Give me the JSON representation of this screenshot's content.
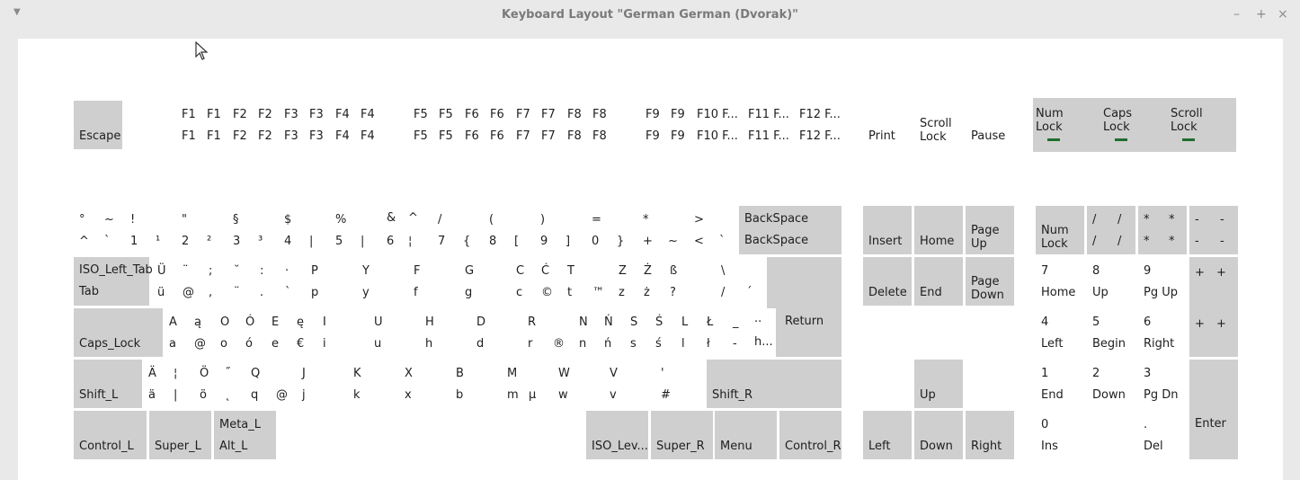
{
  "window": {
    "title": "Keyboard Layout \"German German (Dvorak)\"",
    "menu_icon": "triangle-down-icon",
    "minimize": "–",
    "maximize": "+",
    "close": "×"
  },
  "colors": {
    "key_grey": "#cfcfcf",
    "key_white": "#ffffff",
    "indicator": "#1f6e2e",
    "title_text": "#7a7a7a"
  },
  "keys": {
    "escape": [
      "Escape"
    ],
    "f1": [
      "F1",
      "F1",
      "F1",
      "F1"
    ],
    "f2": [
      "F2",
      "F2",
      "F2",
      "F2"
    ],
    "f3": [
      "F3",
      "F3",
      "F3",
      "F3"
    ],
    "f4": [
      "F4",
      "F4",
      "F4",
      "F4"
    ],
    "f5": [
      "F5",
      "F5",
      "F5",
      "F5"
    ],
    "f6": [
      "F6",
      "F6",
      "F6",
      "F6"
    ],
    "f7": [
      "F7",
      "F7",
      "F7",
      "F7"
    ],
    "f8": [
      "F8",
      "F8",
      "F8",
      "F8"
    ],
    "f9": [
      "F9",
      "F9",
      "F9",
      "F9"
    ],
    "f10": [
      "F10 F...",
      "F10 F..."
    ],
    "f11": [
      "F11 F...",
      "F11 F..."
    ],
    "f12": [
      "F12 F...",
      "F12 F..."
    ],
    "print": [
      "Print"
    ],
    "scroll_lock": [
      "Scroll",
      "Lock"
    ],
    "pause": [
      "Pause"
    ],
    "ind_num": [
      "Num",
      "Lock"
    ],
    "ind_caps": [
      "Caps",
      "Lock"
    ],
    "ind_scroll": [
      "Scroll",
      "Lock"
    ],
    "tilde": [
      "°",
      "~",
      "^",
      "`"
    ],
    "d1": [
      "!",
      "1",
      "¹"
    ],
    "d2": [
      "\"",
      "2",
      "²"
    ],
    "d3": [
      "§",
      "3",
      "³"
    ],
    "d4": [
      "$",
      "4",
      "|"
    ],
    "d5": [
      "%",
      "5",
      "|"
    ],
    "d6": [
      "&",
      "^",
      "6",
      "¦"
    ],
    "d7": [
      "/",
      "7",
      "{"
    ],
    "d8": [
      "(",
      "8",
      "["
    ],
    "d9": [
      ")",
      "9",
      "]"
    ],
    "d0": [
      "=",
      "0",
      "}"
    ],
    "plus": [
      "*",
      "+",
      "~"
    ],
    "lt": [
      ">",
      "<",
      "`"
    ],
    "backspace": [
      "BackSpace",
      "BackSpace"
    ],
    "tab": [
      "ISO_Left_Tab",
      "Tab"
    ],
    "q_ue": [
      "Ü",
      "¨",
      "ü",
      "@"
    ],
    "semi": [
      ";",
      "˘",
      ",",
      "¨"
    ],
    "colon": [
      ":",
      "·",
      ".",
      "`"
    ],
    "p": [
      "P",
      "p"
    ],
    "y": [
      "Y",
      "y"
    ],
    "f": [
      "F",
      "f"
    ],
    "g": [
      "G",
      "g"
    ],
    "c": [
      "C",
      "Ć",
      "c",
      "©"
    ],
    "t": [
      "T",
      "t",
      "™"
    ],
    "z": [
      "Z",
      "Ż",
      "z",
      "ż"
    ],
    "ss": [
      "ß",
      "?"
    ],
    "bslash": [
      "\\",
      "/",
      "´"
    ],
    "return": [
      "Return"
    ],
    "caps": [
      "Caps_Lock"
    ],
    "a": [
      "A",
      "ą",
      "a",
      "@"
    ],
    "o": [
      "O",
      "Ó",
      "o",
      "ó"
    ],
    "e": [
      "E",
      "ę",
      "e",
      "€"
    ],
    "i": [
      "I",
      "i"
    ],
    "u": [
      "U",
      "u"
    ],
    "h": [
      "H",
      "h"
    ],
    "d": [
      "D",
      "d"
    ],
    "r": [
      "R",
      "r",
      "®"
    ],
    "n": [
      "N",
      "Ń",
      "n",
      "ń"
    ],
    "s": [
      "S",
      "Ś",
      "s",
      "ś"
    ],
    "l": [
      "L",
      "Ł",
      "l",
      "ł"
    ],
    "dash": [
      "_",
      "..",
      "-",
      "h..."
    ],
    "shift_l": [
      "Shift_L"
    ],
    "ae": [
      "Ä",
      "¦",
      "ä",
      "|"
    ],
    "oe": [
      "Ö",
      "˝",
      "ö",
      "˛"
    ],
    "q": [
      "Q",
      "q",
      "@"
    ],
    "j": [
      "J",
      "j"
    ],
    "k": [
      "K",
      "k"
    ],
    "x": [
      "X",
      "x"
    ],
    "b": [
      "B",
      "b"
    ],
    "m": [
      "M",
      "m",
      "µ"
    ],
    "w": [
      "W",
      "w"
    ],
    "v": [
      "V",
      "v"
    ],
    "hash": [
      "'",
      "#"
    ],
    "shift_r": [
      "Shift_R"
    ],
    "control_l": [
      "Control_L"
    ],
    "super_l": [
      "Super_L"
    ],
    "alt_l": [
      "Meta_L",
      "Alt_L"
    ],
    "iso_level": [
      "ISO_Lev..."
    ],
    "super_r": [
      "Super_R"
    ],
    "menu": [
      "Menu"
    ],
    "control_r": [
      "Control_R"
    ],
    "insert": [
      "Insert"
    ],
    "home": [
      "Home"
    ],
    "page_up": [
      "Page",
      "Up"
    ],
    "delete": [
      "Delete"
    ],
    "end": [
      "End"
    ],
    "page_down": [
      "Page",
      "Down"
    ],
    "up": [
      "Up"
    ],
    "left": [
      "Left"
    ],
    "down": [
      "Down"
    ],
    "right": [
      "Right"
    ],
    "kp_numlock": [
      "Num",
      "Lock"
    ],
    "kp_div": [
      "/",
      "/",
      "/",
      "/"
    ],
    "kp_mul": [
      "*",
      "*",
      "*",
      "*"
    ],
    "kp_sub": [
      "-",
      "-",
      "-",
      "-"
    ],
    "kp7": [
      "7",
      "Home"
    ],
    "kp8": [
      "8",
      "Up"
    ],
    "kp9": [
      "9",
      "Pg Up"
    ],
    "kp_add": [
      "+",
      "+",
      "+",
      "+"
    ],
    "kp4": [
      "4",
      "Left"
    ],
    "kp5": [
      "5",
      "Begin"
    ],
    "kp6": [
      "6",
      "Right"
    ],
    "kp1": [
      "1",
      "End"
    ],
    "kp2": [
      "2",
      "Down"
    ],
    "kp3": [
      "3",
      "Pg Dn"
    ],
    "kp_enter": [
      "Enter"
    ],
    "kp0": [
      "0",
      "Ins"
    ],
    "kp_dec": [
      ".",
      "Del"
    ]
  }
}
